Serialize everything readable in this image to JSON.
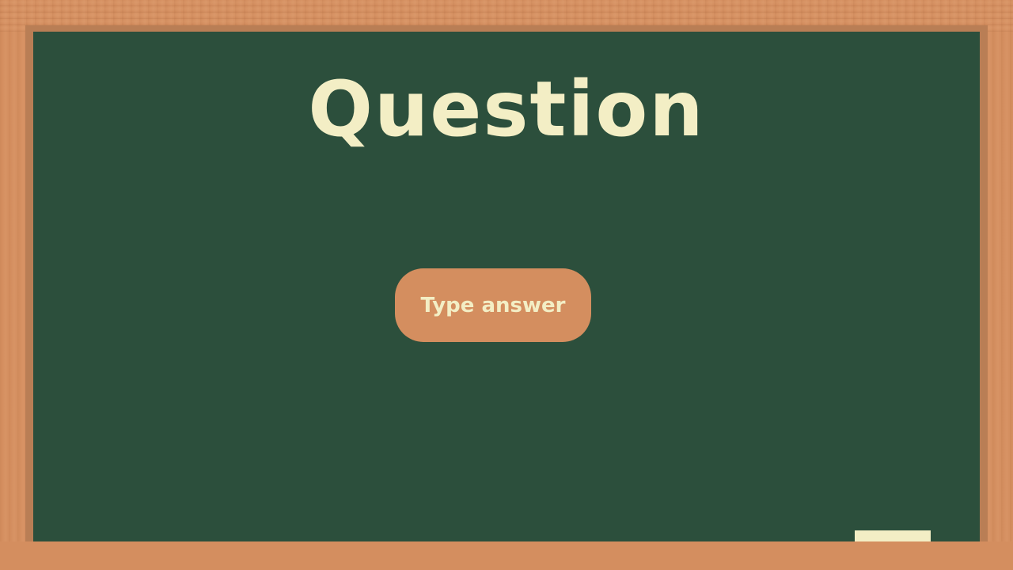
{
  "board": {
    "title": "Question",
    "answer_button_label": "Type answer"
  },
  "colors": {
    "frame_wood": "#d48e5f",
    "board_green": "#2c4f3c",
    "chalk_text": "#f3eec5"
  }
}
